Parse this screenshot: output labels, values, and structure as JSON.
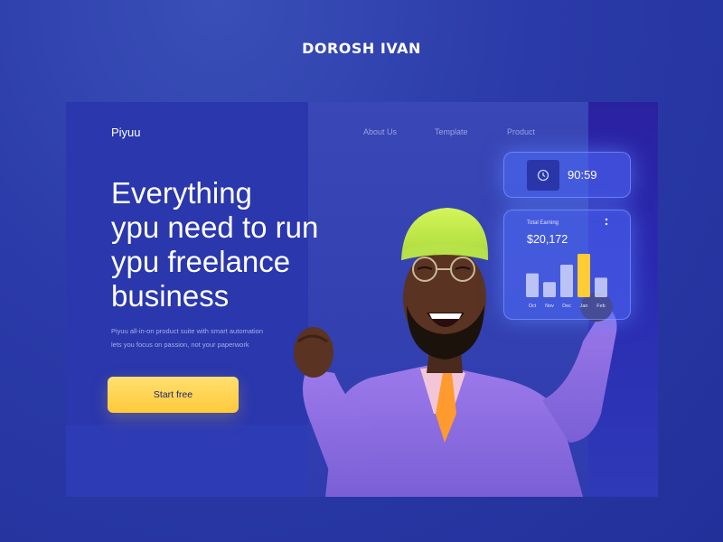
{
  "brand": "DOROSH IVAN",
  "site": {
    "logo": "Piyuu",
    "nav": [
      "About Us",
      "Template",
      "Product"
    ]
  },
  "hero": {
    "headline_lines": [
      "Everything",
      "ypu need to run",
      "ypu freelance",
      "business"
    ],
    "subtext": "Piyuu all-in-on product suite with smart automation lets you focus on passion, not your paperwork",
    "cta_label": "Start free"
  },
  "widgets": {
    "timer": {
      "icon": "clock-icon",
      "value": "90:59"
    },
    "earning": {
      "title": "Total Earning",
      "value": "$20,172",
      "more_icon": "vertical-dots-icon",
      "months": [
        "Oct",
        "Nov",
        "Dec",
        "Jan",
        "Feb"
      ],
      "bar_levels": [
        0.55,
        0.35,
        0.75,
        1.0,
        0.45
      ],
      "highlight_index": 3
    }
  },
  "colors": {
    "background": "#2a3aa8",
    "cta": "#ffc93a",
    "hat": "#c9f04a",
    "jacket": "#8e6ce0",
    "highlight_bar": "#ffcc33"
  }
}
